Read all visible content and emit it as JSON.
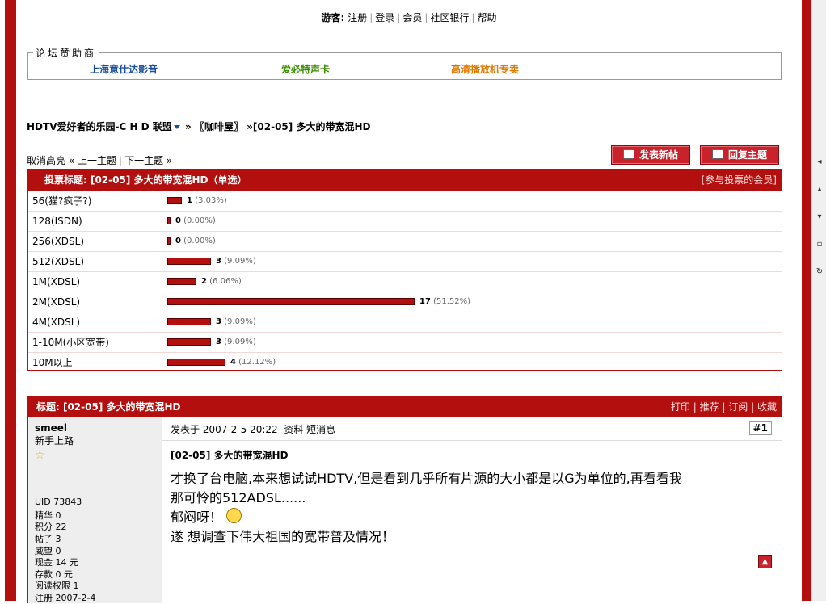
{
  "topnav": {
    "guest_label": "游客:",
    "links": [
      "注册",
      "登录",
      "会员",
      "社区银行",
      "帮助"
    ]
  },
  "sponsors": {
    "legend": "论坛赞助商",
    "items": [
      {
        "label": "上海意仕达影音",
        "color": "#1a4ea0"
      },
      {
        "label": "爱必特声卡",
        "color": "#3a8c00"
      },
      {
        "label": "高清播放机专卖",
        "color": "#e07800"
      }
    ]
  },
  "breadcrumb": {
    "forum": "HDTV爱好者的乐园-C H D 联盟",
    "sep1": "»",
    "section": "〖咖啡屋〗",
    "sep2": "»",
    "thread": "[02-05] 多大的带宽混HD"
  },
  "threadnav": {
    "cancel": "取消高亮",
    "prev_arrow": "«",
    "prev": "上一主题",
    "next": "下一主题",
    "next_arrow": "»"
  },
  "buttons": {
    "new_post": "发表新帖",
    "reply": "回复主题"
  },
  "poll": {
    "title": "投票标题: [02-05] 多大的带宽混HD（单选）",
    "voters_link": "[参与投票的会员]",
    "options": [
      {
        "label": "56(猫?疯子?)",
        "count": "1",
        "pct": "(3.03%)",
        "value": 3.03
      },
      {
        "label": "128(ISDN)",
        "count": "0",
        "pct": "(0.00%)",
        "value": 0
      },
      {
        "label": "256(XDSL)",
        "count": "0",
        "pct": "(0.00%)",
        "value": 0
      },
      {
        "label": "512(XDSL)",
        "count": "3",
        "pct": "(9.09%)",
        "value": 9.09
      },
      {
        "label": "1M(XDSL)",
        "count": "2",
        "pct": "(6.06%)",
        "value": 6.06
      },
      {
        "label": "2M(XDSL)",
        "count": "17",
        "pct": "(51.52%)",
        "value": 51.52
      },
      {
        "label": "4M(XDSL)",
        "count": "3",
        "pct": "(9.09%)",
        "value": 9.09
      },
      {
        "label": "1-10M(小区宽带)",
        "count": "3",
        "pct": "(9.09%)",
        "value": 9.09
      },
      {
        "label": "10M以上",
        "count": "4",
        "pct": "(12.12%)",
        "value": 12.12
      }
    ]
  },
  "post": {
    "header_title": "标题: [02-05] 多大的带宽混HD",
    "actions": [
      "打印",
      "推荐",
      "订阅",
      "收藏"
    ],
    "author": "smeel",
    "rank": "新手上路",
    "stats": [
      "UID 73843",
      "精华 0",
      "积分 22",
      "帖子 3",
      "威望 0",
      "现金 14 元",
      "存款 0 元",
      "阅读权限 1",
      "注册 2007-2-4"
    ],
    "posted": "发表于 2007-2-5 20:22",
    "profile": "资料",
    "pm": "短消息",
    "floor": "#1",
    "subject": "[02-05] 多大的带宽混HD",
    "body_line1": "才换了台电脑,本来想试试HDTV,但是看到几乎所有片源的大小都是以G为单位的,再看看我",
    "body_line2": "那可怜的512ADSL......",
    "body_line3": "郁闷呀！",
    "body_line4": "遂 想调查下伟大祖国的宽带普及情况！"
  }
}
